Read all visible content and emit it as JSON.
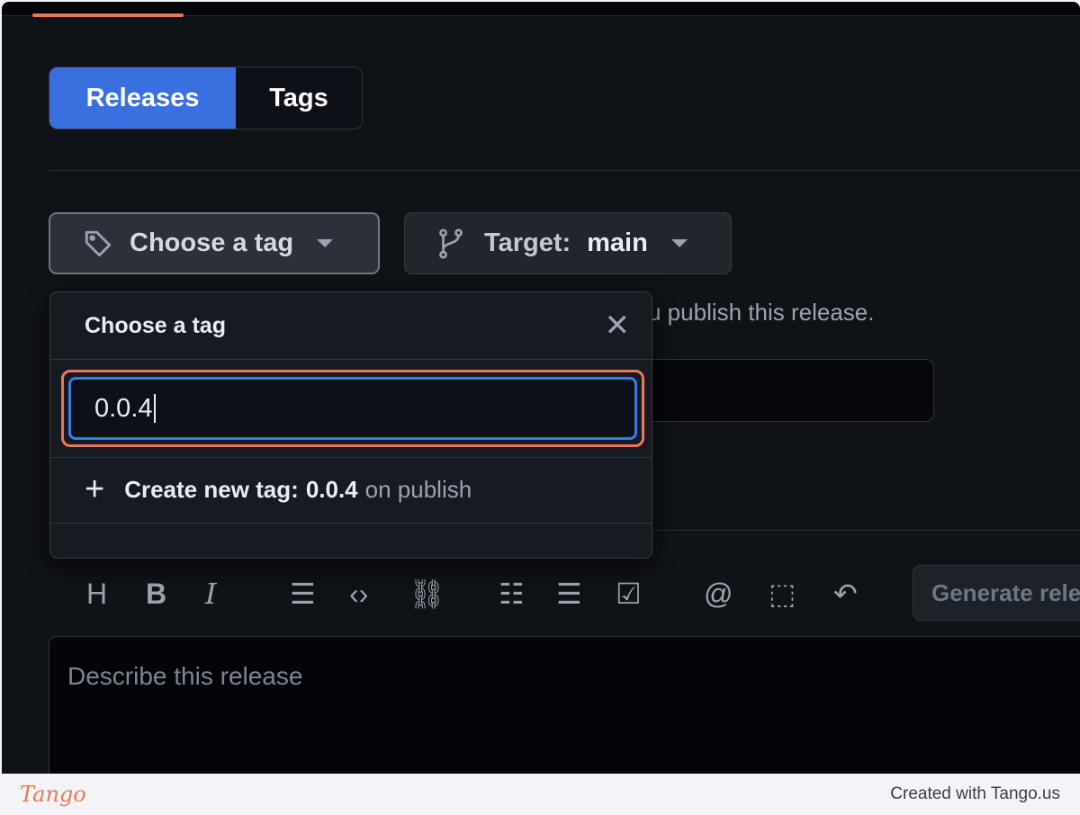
{
  "tabs": {
    "releases": "Releases",
    "tags": "Tags",
    "active": "Releases"
  },
  "tag_button": {
    "label": "Choose a tag",
    "icon": "tag-icon"
  },
  "target_button": {
    "prefix": "Target:",
    "branch": "main",
    "icon": "git-branch-icon"
  },
  "background_hint": "u publish this release.",
  "dropdown": {
    "title": "Choose a tag",
    "close_icon": "close-icon",
    "input_value": "0.0.4",
    "create_prefix": "Create new tag:",
    "create_tag": "0.0.4",
    "create_suffix": "on publish"
  },
  "toolbar": {
    "icons": [
      "heading-icon",
      "bold-icon",
      "italic-icon",
      "quote-icon",
      "code-icon",
      "link-icon",
      "bulleted-list-icon",
      "numbered-list-icon",
      "task-list-icon",
      "mention-icon",
      "reference-icon",
      "reply-icon"
    ],
    "generate_label": "Generate release notes"
  },
  "description": {
    "placeholder": "Describe this release"
  },
  "footer": {
    "logo": "Tango",
    "credit": "Created with Tango.us"
  },
  "colors": {
    "accent": "#3a6fe0",
    "highlight": "#ec7856",
    "background": "#0f1216"
  }
}
